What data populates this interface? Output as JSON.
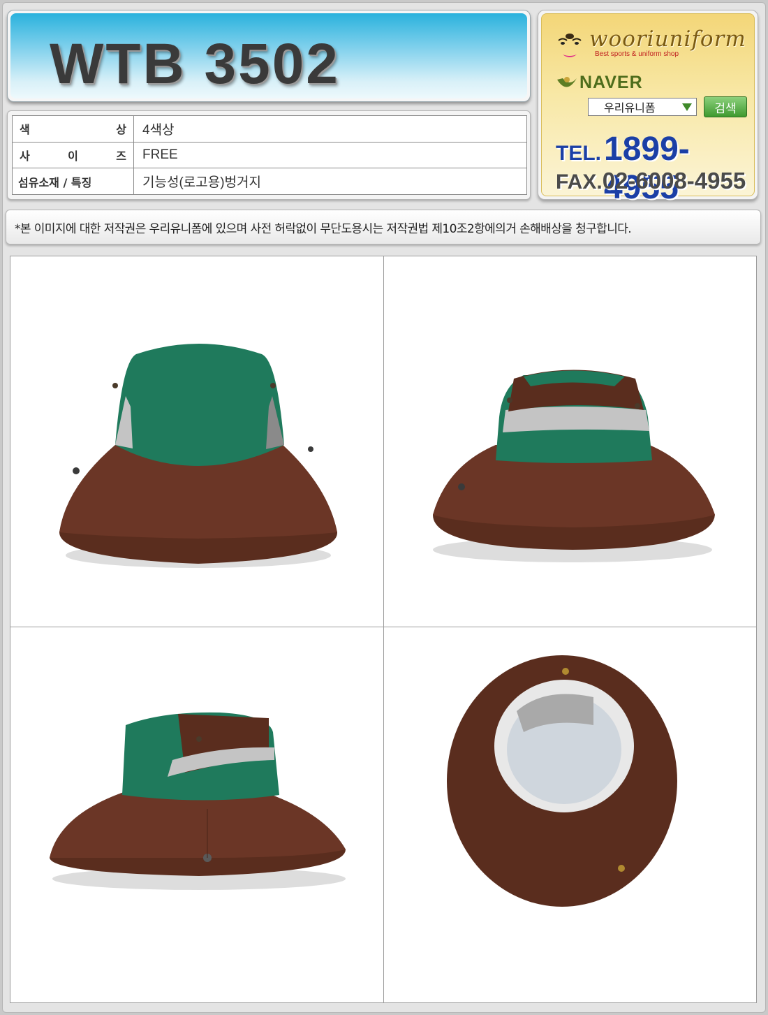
{
  "product": {
    "code": "WTB 3502"
  },
  "spec": {
    "rows": [
      {
        "label_left": "색",
        "label_right": "상",
        "value": "4색상"
      },
      {
        "label_left": "사",
        "label_mid": "이",
        "label_right": "즈",
        "value": "FREE"
      },
      {
        "label_full": "섬유소재 / 특징",
        "value": "기능성(로고용)벙거지"
      }
    ]
  },
  "shop": {
    "brand": "wooriuniform",
    "tagline": "Best sports & uniform shop",
    "search_engine": "NAVER",
    "search_keyword": "우리유니폼",
    "search_button": "검색",
    "tel_label": "TEL.",
    "tel_number": "1899-4955",
    "fax_label": "FAX.",
    "fax_number": "02-6008-4955"
  },
  "notice": "*본 이미지에 대한 저작권은 우리유니폼에 있으며 사전 허락없이 무단도용시는 저작권법 제10조2항에의거 손해배상을 청구합니다.",
  "photos": [
    {
      "name": "hat-front-photo"
    },
    {
      "name": "hat-back-photo"
    },
    {
      "name": "hat-side-photo"
    },
    {
      "name": "hat-inside-photo"
    }
  ],
  "colors": {
    "hat_green": "#1f7a5c",
    "hat_brown": "#5a2d1e",
    "mesh_gray": "#c4c4c4",
    "title_blue": "#2ab2dd",
    "logo_gold": "#f3d678"
  }
}
